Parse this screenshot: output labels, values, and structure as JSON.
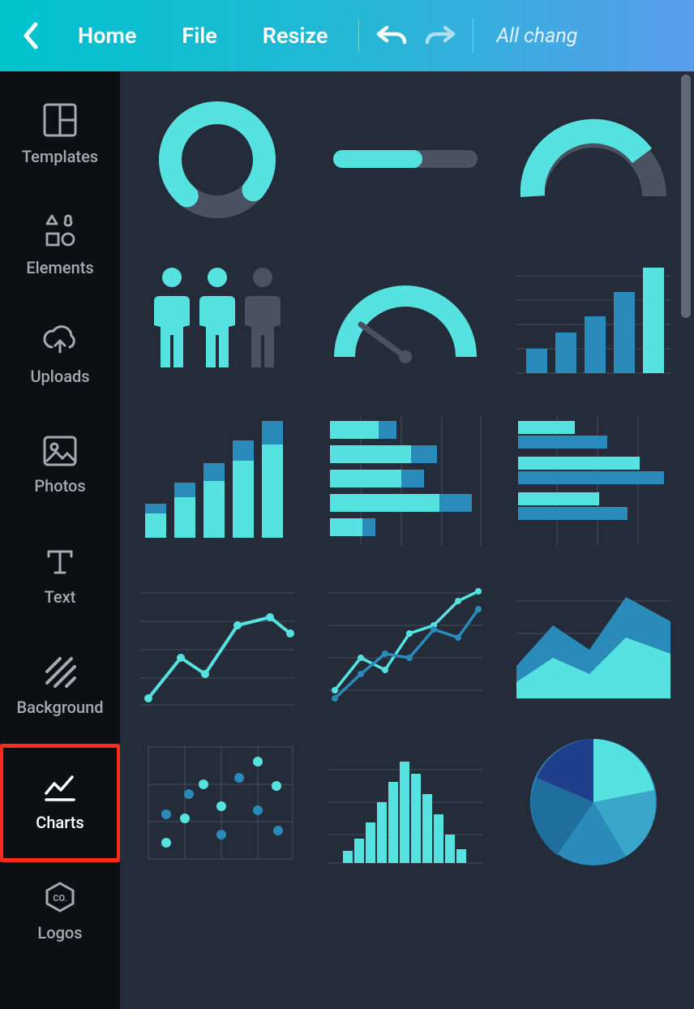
{
  "topbar": {
    "home": "Home",
    "file": "File",
    "resize": "Resize",
    "status": "All chang"
  },
  "sidebar": {
    "templates": "Templates",
    "elements": "Elements",
    "uploads": "Uploads",
    "photos": "Photos",
    "text": "Text",
    "background": "Background",
    "charts": "Charts",
    "logos": "Logos"
  },
  "charts": {
    "items": [
      "donut-progress",
      "progress-bar",
      "half-donut",
      "pictogram-people",
      "gauge",
      "bar-chart",
      "stacked-bar-chart",
      "horizontal-stacked-bar",
      "grouped-horizontal-bar",
      "line-chart",
      "multi-line-chart",
      "area-chart",
      "scatter-plot",
      "histogram",
      "pie-chart"
    ]
  },
  "colors": {
    "accent": "#57e2e2",
    "accent2": "#2a8ab9",
    "accent3": "#1f6e9e",
    "grid": "#454d5c",
    "muted": "#4a5262"
  }
}
